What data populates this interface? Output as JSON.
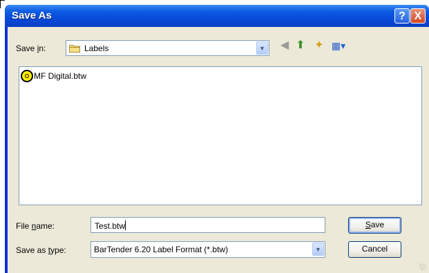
{
  "window": {
    "title": "Save As"
  },
  "title_buttons": {
    "help": "?",
    "close": "X"
  },
  "save_in": {
    "label_prefix": "Save ",
    "label_key": "i",
    "label_suffix": "n:",
    "value": "Labels"
  },
  "toolbar": {
    "back_icon": "back-arrow-icon",
    "up_icon": "up-folder-icon",
    "new_folder_icon": "new-folder-icon",
    "views_icon": "views-menu-icon",
    "glyphs": {
      "back": "◀",
      "up": "⬆",
      "new_folder": "✦",
      "views": "▦▾"
    }
  },
  "files": [
    {
      "name": "MF Digital.btw",
      "icon": "bartender-file-icon"
    }
  ],
  "file_name": {
    "label_prefix": "File ",
    "label_key": "n",
    "label_suffix": "ame:",
    "value": "Test.btw"
  },
  "save_as_type": {
    "label_prefix": "Save as ",
    "label_key": "t",
    "label_suffix": "ype:",
    "value": "BarTender 6.20 Label Format (*.btw)"
  },
  "buttons": {
    "save_key": "S",
    "save_rest": "ave",
    "cancel": "Cancel"
  },
  "colors": {
    "title_blue": "#0054e3",
    "dialog_bg": "#ece9d8",
    "close_red": "#d6471f"
  }
}
